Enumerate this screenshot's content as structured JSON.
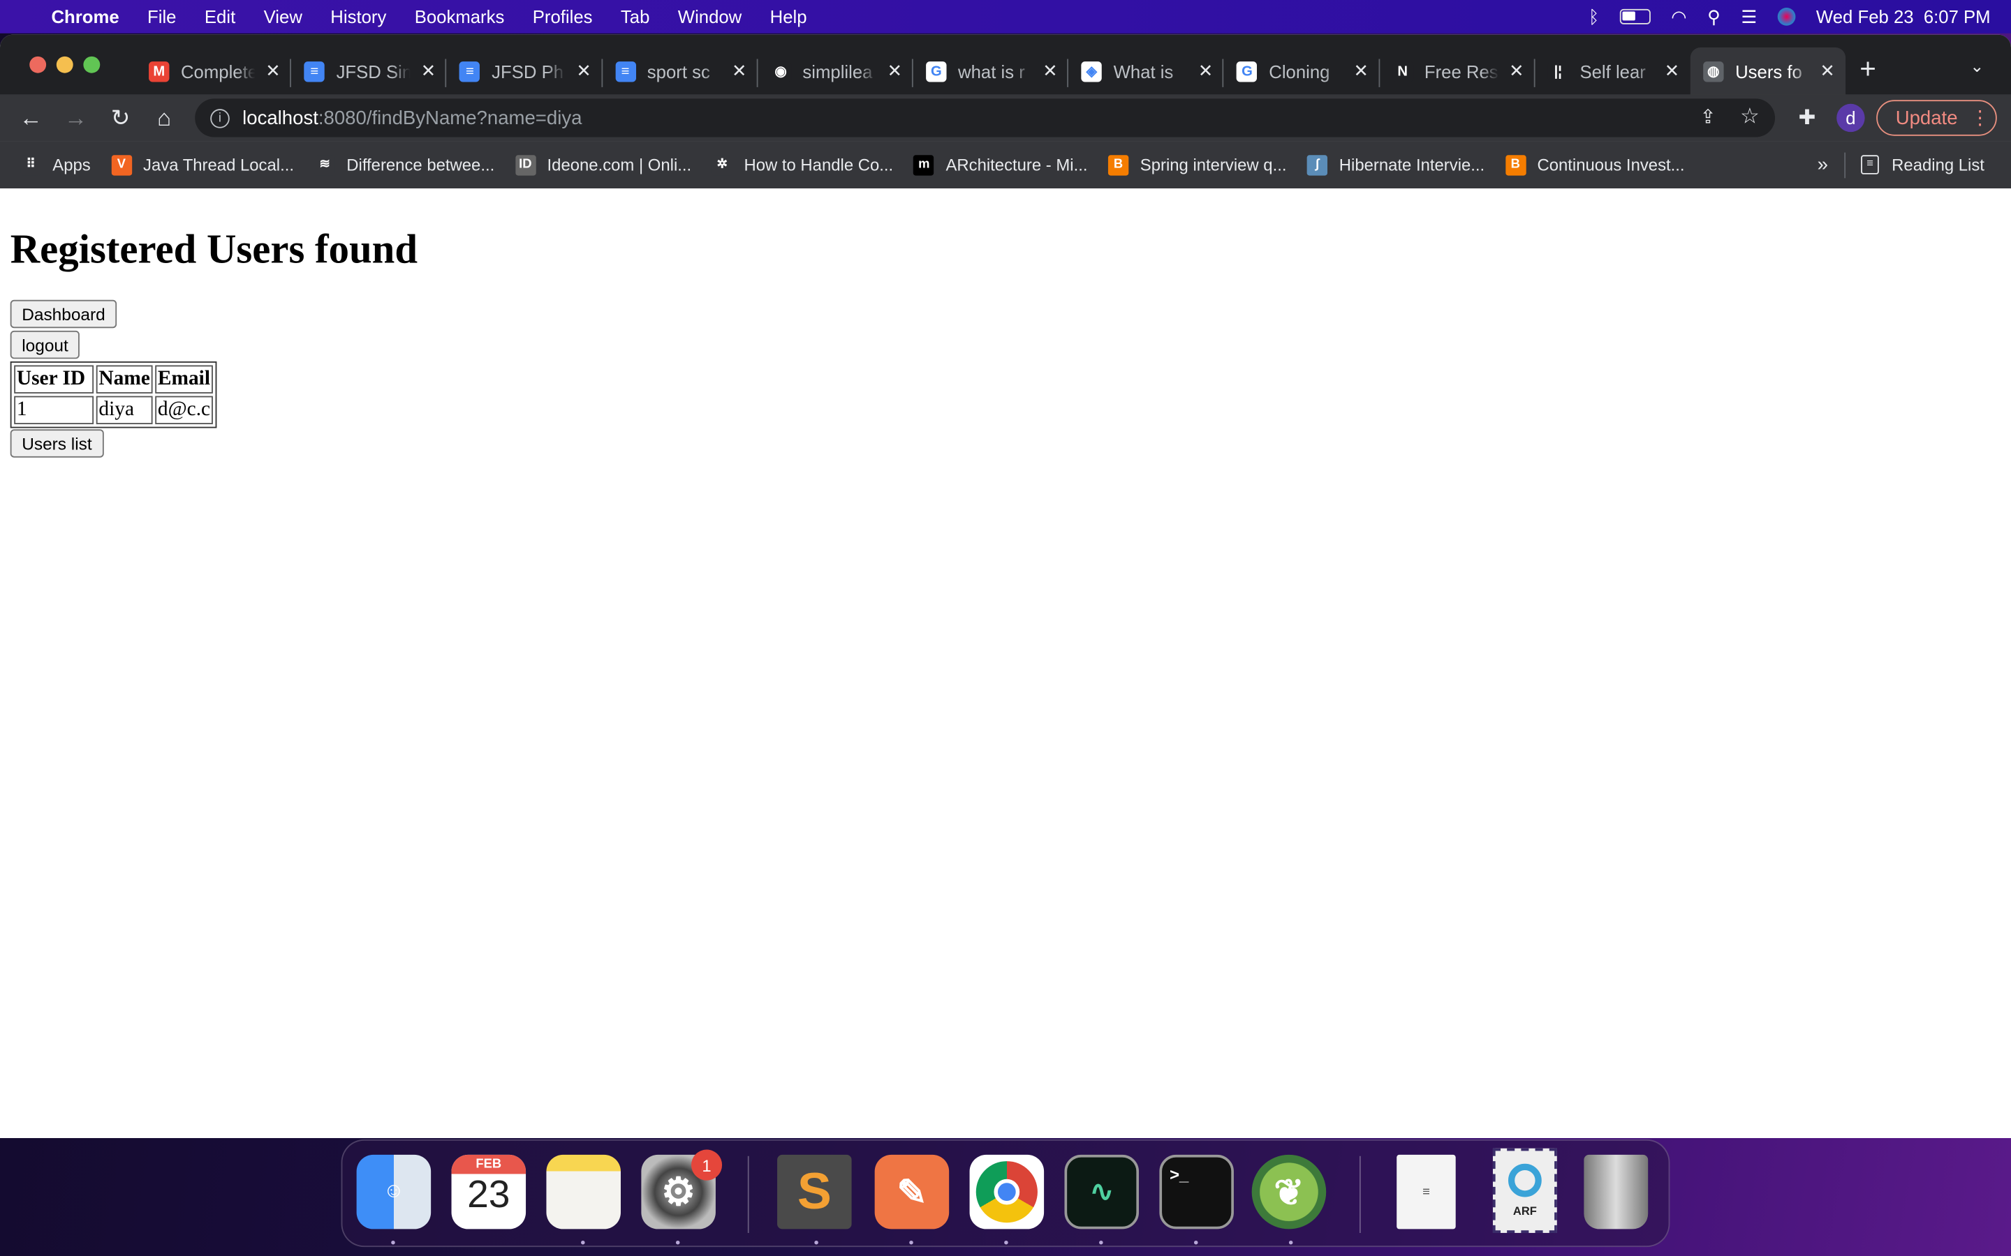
{
  "menubar": {
    "app": "Chrome",
    "items": [
      "File",
      "Edit",
      "View",
      "History",
      "Bookmarks",
      "Profiles",
      "Tab",
      "Window",
      "Help"
    ],
    "clock": "Wed Feb 23  6:07 PM"
  },
  "tabs": [
    {
      "title": "Complete",
      "icon": "gmail-icon",
      "color": "#ea4335",
      "glyph": "M"
    },
    {
      "title": "JFSD Sin",
      "icon": "google-docs-icon",
      "color": "#4285f4",
      "glyph": "≡"
    },
    {
      "title": "JFSD Ph",
      "icon": "google-docs-icon",
      "color": "#4285f4",
      "glyph": "≡"
    },
    {
      "title": "sport sc",
      "icon": "google-docs-icon",
      "color": "#4285f4",
      "glyph": "≡"
    },
    {
      "title": "simplilea",
      "icon": "github-icon",
      "color": "#202124",
      "glyph": "◉"
    },
    {
      "title": "what is r",
      "icon": "google-icon",
      "color": "#ffffff",
      "glyph": "G"
    },
    {
      "title": "What is",
      "icon": "site-icon",
      "color": "#ffffff",
      "glyph": "◈"
    },
    {
      "title": "Cloning",
      "icon": "google-icon",
      "color": "#ffffff",
      "glyph": "G"
    },
    {
      "title": "Free Res",
      "icon": "n-logo-icon",
      "color": "#202124",
      "glyph": "N"
    },
    {
      "title": "Self lear",
      "icon": "bars-icon",
      "color": "#202124",
      "glyph": "|¦"
    },
    {
      "title": "Users fo",
      "icon": "globe-icon",
      "color": "#5f6368",
      "glyph": "◍",
      "active": true
    }
  ],
  "toolbar": {
    "url_host": "localhost",
    "url_rest": ":8080/findByName?name=diya",
    "profile_initial": "d",
    "update_label": "Update"
  },
  "bookmarks": [
    {
      "label": "Apps",
      "color": "#35363a",
      "glyph": "⠿"
    },
    {
      "label": "Java Thread Local...",
      "color": "#f26522",
      "glyph": "V"
    },
    {
      "label": "Difference betwee...",
      "color": "#35363a",
      "glyph": "≋"
    },
    {
      "label": "Ideone.com | Onli...",
      "color": "#666666",
      "glyph": "ID"
    },
    {
      "label": "How to Handle Co...",
      "color": "#35363a",
      "glyph": "✲"
    },
    {
      "label": "ARchitecture - Mi...",
      "color": "#000000",
      "glyph": "m"
    },
    {
      "label": "Spring interview q...",
      "color": "#f57d00",
      "glyph": "B"
    },
    {
      "label": "Hibernate Intervie...",
      "color": "#5b8db8",
      "glyph": "∫"
    },
    {
      "label": "Continuous Invest...",
      "color": "#f57d00",
      "glyph": "B"
    }
  ],
  "bookmarks_overflow": "»",
  "reading_list": "Reading List",
  "page": {
    "heading": "Registered Users found",
    "dashboard_button": "Dashboard",
    "logout_button": "logout",
    "table": {
      "headers": [
        "User ID",
        "Name",
        "Email"
      ],
      "rows": [
        [
          "1",
          "diya",
          "d@c.c"
        ]
      ]
    },
    "users_list_button": "Users list"
  },
  "dock": {
    "calendar_month": "FEB",
    "calendar_day": "23",
    "settings_badge": "1",
    "arf_label": "ARF",
    "terminal_prompt": ">_"
  }
}
